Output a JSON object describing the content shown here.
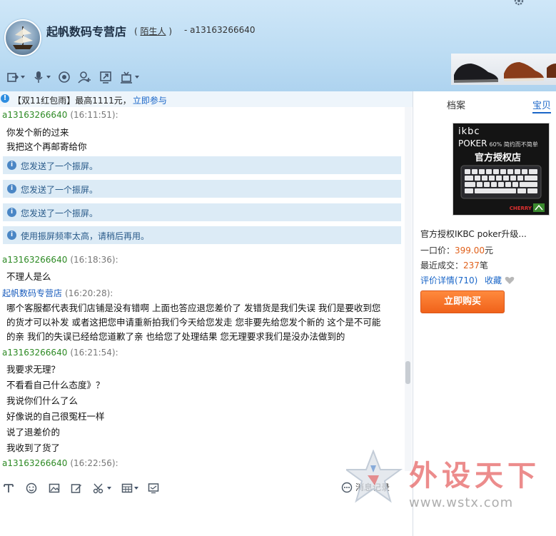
{
  "header": {
    "shop_name": "起帆数码专营店",
    "stranger_open": "(",
    "stranger_label": "陌生人",
    "stranger_close": ")",
    "user_separator": "- ",
    "user_id": "a13163266640"
  },
  "toolbar": {
    "items": [
      "transfer-icon",
      "microphone-icon",
      "video-icon",
      "add-contact-icon",
      "screen-share-icon",
      "remote-assist-icon"
    ]
  },
  "promo": {
    "icon": "!",
    "text": "【双11红包雨】最高1111元，",
    "link": "立即参与"
  },
  "chat": {
    "messages": [
      {
        "sender": "a13163266640",
        "time": "(16:11:51):",
        "lines": [
          "你发个新的过来",
          "我把这个再邮寄给你"
        ]
      },
      {
        "notice": "您发送了一个振屏。"
      },
      {
        "notice": "您发送了一个振屏。"
      },
      {
        "notice": "您发送了一个振屏。"
      },
      {
        "notice": "使用振屏频率太高，请稍后再用。"
      },
      {
        "sender": "a13163266640",
        "time": "(16:18:36):",
        "lines": [
          "不理人是么"
        ]
      },
      {
        "sender": "起帆数码专营店",
        "time": "(16:20:28):",
        "lines": [
          "哪个客服都代表我们店铺是没有错啊 上面也答应退您差价了 发错货是我们失误 我们是要收到您",
          "的货才可以补发 或者这把您申请重新拍我们今天给您发走 您非要先给您发个新的 这个是不可能",
          "的亲 我们的失误已经给您道歉了亲 也给您了处理结果 您无理要求我们是没办法做到的"
        ]
      },
      {
        "sender": "a13163266640",
        "time": "(16:21:54):",
        "lines": [
          "我要求无理？",
          "不看看自己什么态度》？",
          "我说你们什么了么",
          "好像说的自己很冤枉一样",
          "说了退差价的",
          "我收到了货了"
        ]
      },
      {
        "sender": "a13163266640",
        "time": "(16:22:56):",
        "lines": []
      }
    ]
  },
  "right_panel": {
    "tab_profile": "档案",
    "tab_product": "宝贝",
    "product_image": {
      "brand": "ikbc",
      "model": "POKER",
      "tagline": "60% 简约而不简单",
      "headline": "官方授权店",
      "switch_brand": "CHERRY"
    },
    "product_title": "官方授权IKBC poker升级...",
    "price_label": "一口价：",
    "price_value": "399.00",
    "price_unit": "元",
    "sold_label": "最近成交：",
    "sold_value": "237",
    "sold_unit": "笔",
    "reviews": "评价详情(710)",
    "favorite": "收藏",
    "buy_button": "立即购买"
  },
  "input_toolbar": {
    "items": [
      "font-icon",
      "emoji-icon",
      "image-icon",
      "edit-icon",
      "screenshot-icon",
      "table-icon",
      "display-icon"
    ],
    "history_label": "消息记录"
  },
  "watermark": {
    "text": "外设天下",
    "url": "www.wstx.com"
  },
  "colors": {
    "header_bg": "#bcdcf3",
    "sender_name": "#2d8a24",
    "shop_name": "#1a5dbd",
    "notice_bg": "#dcebf6",
    "price": "#e0601a",
    "buy_button": "#f0621a"
  }
}
